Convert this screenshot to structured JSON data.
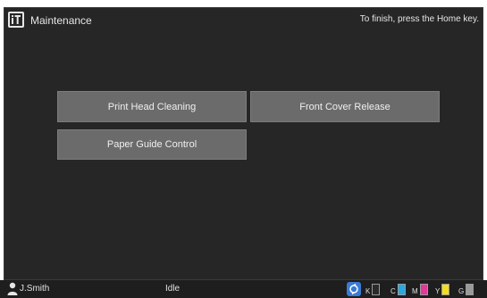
{
  "header": {
    "title": "Maintenance",
    "hint": "To finish, press the Home key.",
    "icon": "maintenance-tool-icon"
  },
  "buttons": {
    "print_head_cleaning": "Print Head Cleaning",
    "front_cover_release": "Front Cover Release",
    "paper_guide_control": "Paper Guide Control"
  },
  "status_bar": {
    "user": "J.Smith",
    "state": "Idle",
    "user_icon": "user-icon",
    "network_icon": "network-icon",
    "toners": [
      {
        "label": "K",
        "level": 0.0,
        "color": "#1a1a1a"
      },
      {
        "label": "C",
        "level": 1.0,
        "color": "#29a8e0"
      },
      {
        "label": "M",
        "level": 1.0,
        "color": "#e0399a"
      },
      {
        "label": "Y",
        "level": 1.0,
        "color": "#f2dd1f"
      },
      {
        "label": "G",
        "level": 1.0,
        "color": "#9a9a9a"
      }
    ]
  },
  "colors": {
    "panel_bg": "#262626",
    "button_bg": "#6b6b6b",
    "text": "#e6e6e6"
  }
}
